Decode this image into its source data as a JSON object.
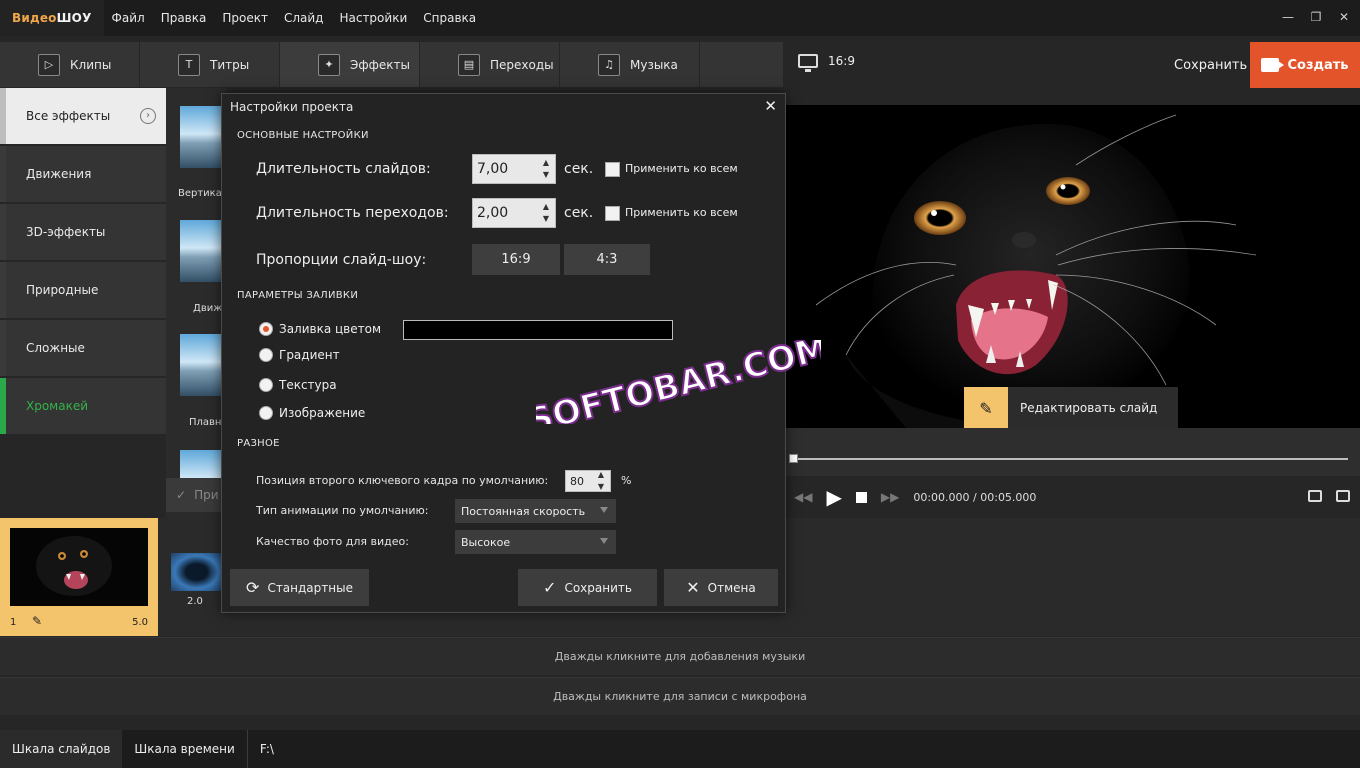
{
  "app": {
    "logo_part1": "Видео",
    "logo_part2": "ШОУ"
  },
  "menu": [
    "Файл",
    "Правка",
    "Проект",
    "Слайд",
    "Настройки",
    "Справка"
  ],
  "window_controls": [
    "—",
    "❐",
    "✕"
  ],
  "tabs": [
    {
      "label": "Клипы",
      "icon": "play-icon"
    },
    {
      "label": "Титры",
      "icon": "text-icon"
    },
    {
      "label": "Эффекты",
      "icon": "magic-wand-icon"
    },
    {
      "label": "Переходы",
      "icon": "film-icon"
    },
    {
      "label": "Музыка",
      "icon": "music-icon"
    }
  ],
  "top_right": {
    "ratio": "16:9",
    "save": "Сохранить",
    "create": "Создать"
  },
  "sidebar": {
    "items": [
      "Все эффекты",
      "Движения",
      "3D-эффекты",
      "Природные",
      "Сложные",
      "Хромакей"
    ]
  },
  "effect_thumbs": [
    "Вертика",
    "Движ",
    "Плавн"
  ],
  "effects_apply_button": "При",
  "timeline": {
    "slide_number": "1",
    "slide_duration": "5.0",
    "transition_duration": "2.0",
    "music_track": "Дважды кликните для добавления музыки",
    "mic_track": "Дважды кликните для записи с микрофона"
  },
  "bottom": {
    "tab_slides": "Шкала слайдов",
    "tab_time": "Шкала времени",
    "path": "F:\\"
  },
  "preview": {
    "edit_slide": "Редактировать слайд",
    "time_current": "00:00.000",
    "time_sep": " / ",
    "time_total": "00:05.000"
  },
  "watermark": "SOFTOBAR.COM",
  "dialog": {
    "title": "Настройки проекта",
    "close": "✕",
    "section_main": "ОСНОВНЫЕ НАСТРОЙКИ",
    "slide_duration_label": "Длительность слайдов:",
    "slide_duration_value": "7,00",
    "transition_duration_label": "Длительность переходов:",
    "transition_duration_value": "2,00",
    "unit_sec": "сек.",
    "apply_all": "Применить ко всем",
    "proportions_label": "Пропорции слайд-шоу:",
    "ratio_16_9": "16:9",
    "ratio_4_3": "4:3",
    "section_fill": "ПАРАМЕТРЫ ЗАЛИВКИ",
    "fill_options": [
      "Заливка цветом",
      "Градиент",
      "Текстура",
      "Изображение"
    ],
    "fill_selected": 0,
    "fill_color": "#000000",
    "section_misc": "РАЗНОЕ",
    "keyframe_label": "Позиция второго ключевого кадра по умолчанию:",
    "keyframe_value": "80",
    "keyframe_unit": "%",
    "animation_label": "Тип анимации по умолчанию:",
    "animation_value": "Постоянная скорость",
    "quality_label": "Качество фото для видео:",
    "quality_value": "Высокое",
    "btn_default": "Стандартные",
    "btn_save": "Сохранить",
    "btn_cancel": "Отмена"
  },
  "colors": {
    "accent": "#e3542a",
    "highlight": "#f4c46c",
    "chroma_green": "#33b24a"
  }
}
